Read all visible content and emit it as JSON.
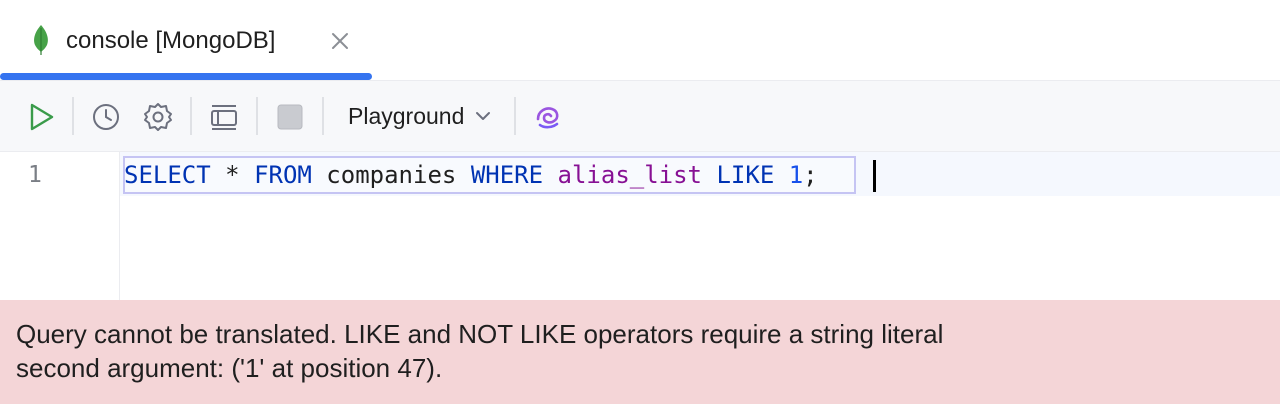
{
  "tab": {
    "title": "console [MongoDB]",
    "icon": "mongodb-leaf-icon",
    "close_icon": "close-icon",
    "accent_color": "#3574f0"
  },
  "toolbar": {
    "run_icon": "play-icon",
    "history_icon": "clock-icon",
    "settings_icon": "gear-icon",
    "layout_icon": "layout-icon",
    "stop_icon": "stop-icon",
    "mode_selector": {
      "value": "Playground",
      "icon": "chevron-down-icon"
    },
    "ai_icon": "ai-assistant-icon"
  },
  "editor": {
    "line_number": "1",
    "tokens": {
      "select": "SELECT",
      "star": " * ",
      "from": "FROM",
      "table": " companies ",
      "where": "WHERE",
      "space1": " ",
      "column": "alias_list",
      "space2": " ",
      "like": "LIKE",
      "space3": " ",
      "value": "1",
      "semicolon": ";"
    },
    "colors": {
      "keyword": "#0033b3",
      "identifier": "#871094",
      "number": "#1750eb"
    }
  },
  "error": {
    "line1": "Query cannot be translated. LIKE and NOT LIKE operators require a string literal",
    "line2": "second argument: ('1' at position 47).",
    "background": "#f4d5d7"
  }
}
